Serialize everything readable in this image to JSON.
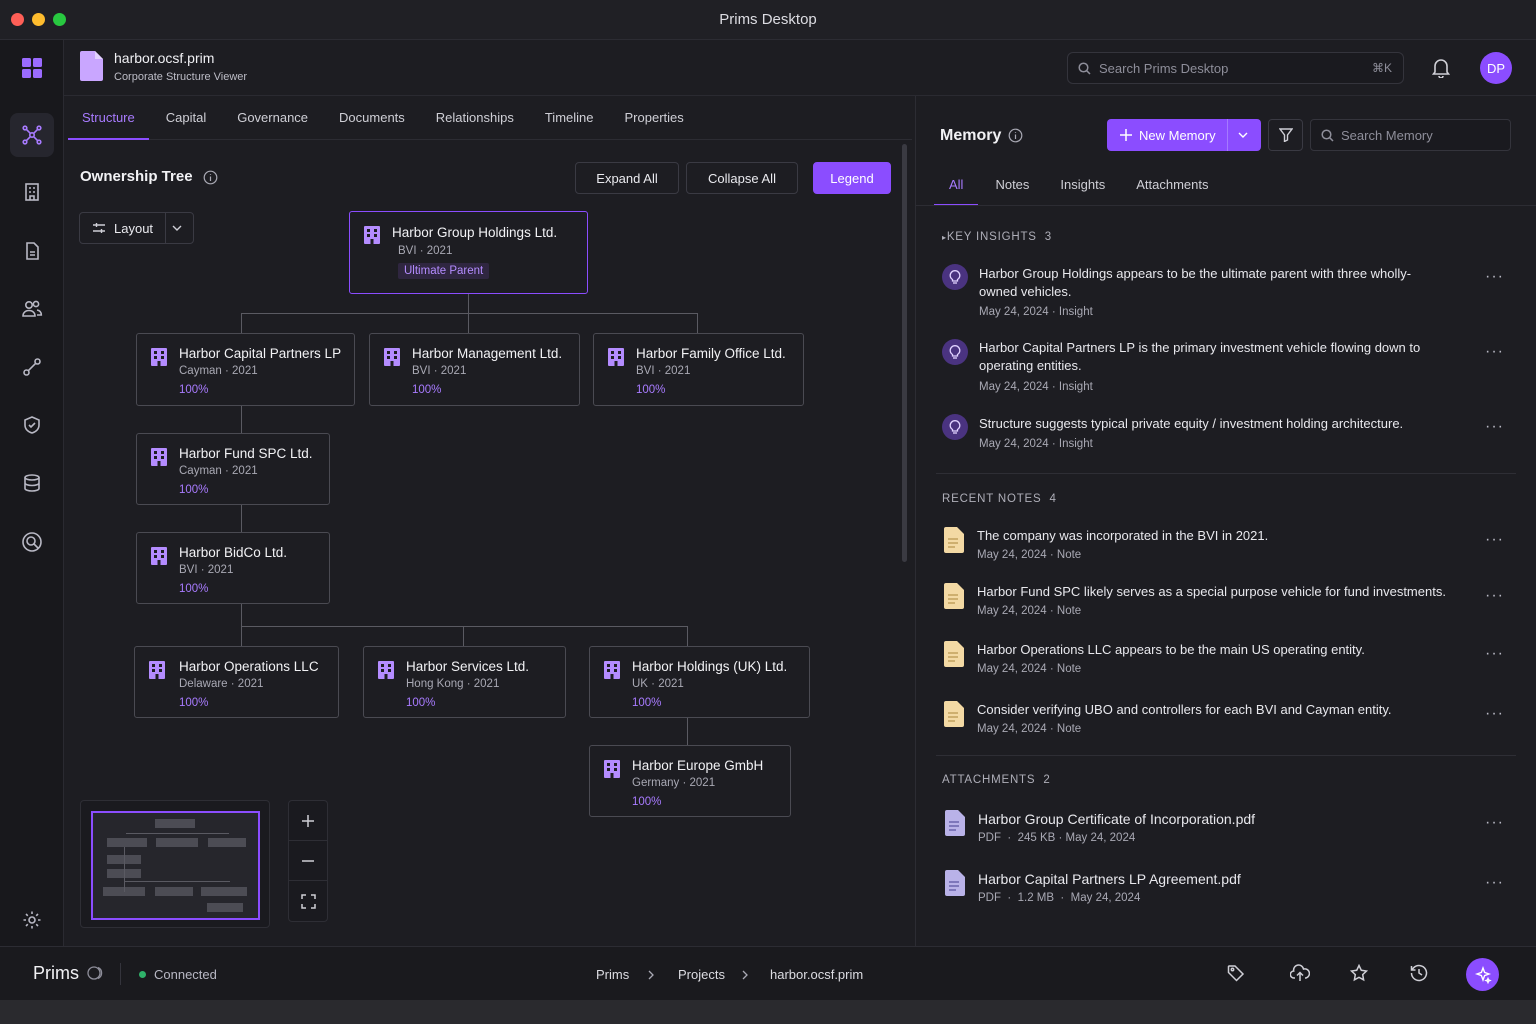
{
  "window": {
    "title": "Prims Desktop"
  },
  "header": {
    "file_name": "harbor.ocsf.prim",
    "file_subtitle": "Corporate Structure Viewer",
    "search_placeholder": "Search Prims Desktop",
    "search_shortcut": "⌘K",
    "avatar_initials": "DP"
  },
  "tabs": [
    "Structure",
    "Capital",
    "Governance",
    "Documents",
    "Relationships",
    "Timeline",
    "Properties"
  ],
  "tree": {
    "title": "Ownership Tree",
    "layout_label": "Layout",
    "expand_all": "Expand All",
    "collapse_all": "Collapse All",
    "legend": "Legend",
    "nodes": [
      {
        "name": "Harbor Group Holdings Ltd.",
        "meta": "BVI · 2021",
        "badge": "Ultimate Parent"
      },
      {
        "name": "Harbor Capital Partners LP",
        "meta": "Cayman · 2021",
        "pct": "100%"
      },
      {
        "name": "Harbor Management Ltd.",
        "meta": "BVI · 2021",
        "pct": "100%"
      },
      {
        "name": "Harbor Family Office Ltd.",
        "meta": "BVI · 2021",
        "pct": "100%"
      },
      {
        "name": "Harbor Fund SPC Ltd.",
        "meta": "Cayman · 2021",
        "pct": "100%"
      },
      {
        "name": "Harbor BidCo Ltd.",
        "meta": "BVI · 2021",
        "pct": "100%"
      },
      {
        "name": "Harbor Operations LLC",
        "meta": "Delaware · 2021",
        "pct": "100%"
      },
      {
        "name": "Harbor Services Ltd.",
        "meta": "Hong Kong · 2021",
        "pct": "100%"
      },
      {
        "name": "Harbor Holdings (UK) Ltd.",
        "meta": "UK · 2021",
        "pct": "100%"
      },
      {
        "name": "Harbor Europe GmbH",
        "meta": "Germany · 2021",
        "pct": "100%"
      }
    ]
  },
  "memory": {
    "title": "Memory",
    "new_memory": "New Memory",
    "search_placeholder": "Search Memory",
    "tabs": [
      "All",
      "Notes",
      "Insights",
      "Attachments"
    ],
    "key_insights": {
      "label": "KEY INSIGHTS",
      "count": "3",
      "items": [
        {
          "text": "Harbor Group Holdings appears to be the ultimate parent with three wholly-owned vehicles.",
          "meta": "May 24, 2024 · Insight"
        },
        {
          "text": "Harbor Capital Partners LP is the primary investment vehicle flowing down to operating entities.",
          "meta": "May 24, 2024 · Insight"
        },
        {
          "text": "Structure suggests typical private equity / investment holding architecture.",
          "meta": "May 24, 2024 · Insight"
        }
      ]
    },
    "recent_notes": {
      "label": "RECENT NOTES",
      "count": "4",
      "items": [
        {
          "text": "The company was incorporated in the BVI in 2021.",
          "meta": "May 24, 2024 · Note"
        },
        {
          "text": "Harbor Fund SPC likely serves as a special purpose vehicle for fund investments.",
          "meta": "May 24, 2024 · Note"
        },
        {
          "text": "Harbor Operations LLC appears to be the main US operating entity.",
          "meta": "May 24, 2024 · Note"
        },
        {
          "text": "Consider verifying UBO and controllers for each BVI and Cayman entity.",
          "meta": "May 24, 2024 · Note"
        }
      ]
    },
    "attachments": {
      "label": "ATTACHMENTS",
      "count": "2",
      "items": [
        {
          "name": "Harbor Group Certificate of Incorporation.pdf",
          "meta": "PDF  ·  245 KB · May 24, 2024"
        },
        {
          "name": "Harbor Capital Partners LP Agreement.pdf",
          "meta": "PDF  ·  1.2 MB  ·  May 24, 2024"
        }
      ]
    }
  },
  "statusbar": {
    "logo": "Prims",
    "status": "Connected",
    "breadcrumb": [
      "Prims",
      "Projects",
      "harbor.ocsf.prim"
    ]
  },
  "colors": {
    "accent": "#8b4dff",
    "connected": "#2fb26a",
    "note": "#f3d9a4"
  }
}
